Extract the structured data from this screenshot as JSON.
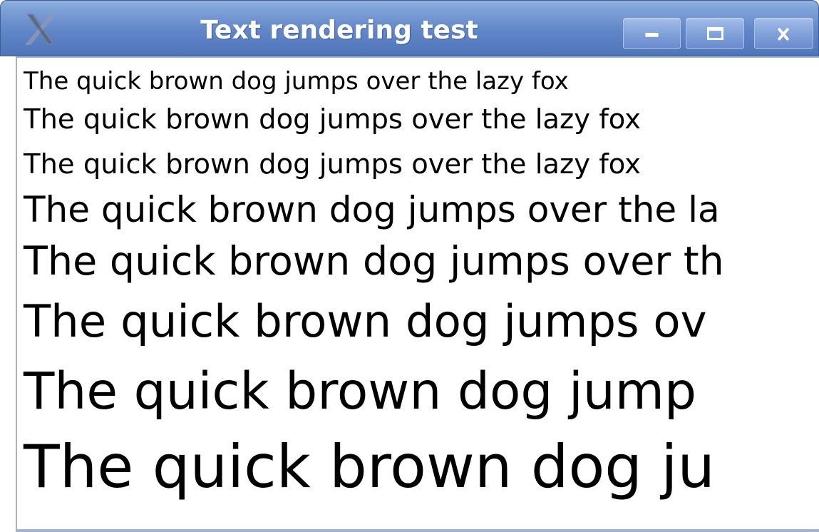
{
  "window": {
    "title": "Text rendering test",
    "app_icon": "x-logo-icon",
    "controls": {
      "minimize_icon": "minimize-icon",
      "maximize_icon": "maximize-icon",
      "close_icon": "close-icon"
    },
    "colors": {
      "titlebar": "#6186c8",
      "title_text": "#ffffff",
      "client_background": "#ffffff",
      "text": "#000000"
    }
  },
  "content": {
    "lines": [
      "The quick brown dog jumps over the lazy fox",
      "The quick brown dog jumps over the lazy fox",
      "The quick brown dog jumps over the lazy fox",
      "The quick brown dog jumps over the la",
      "The quick brown dog jumps over th",
      "The quick brown dog jumps ov",
      "The quick brown dog jump",
      "The quick brown dog ju"
    ]
  }
}
